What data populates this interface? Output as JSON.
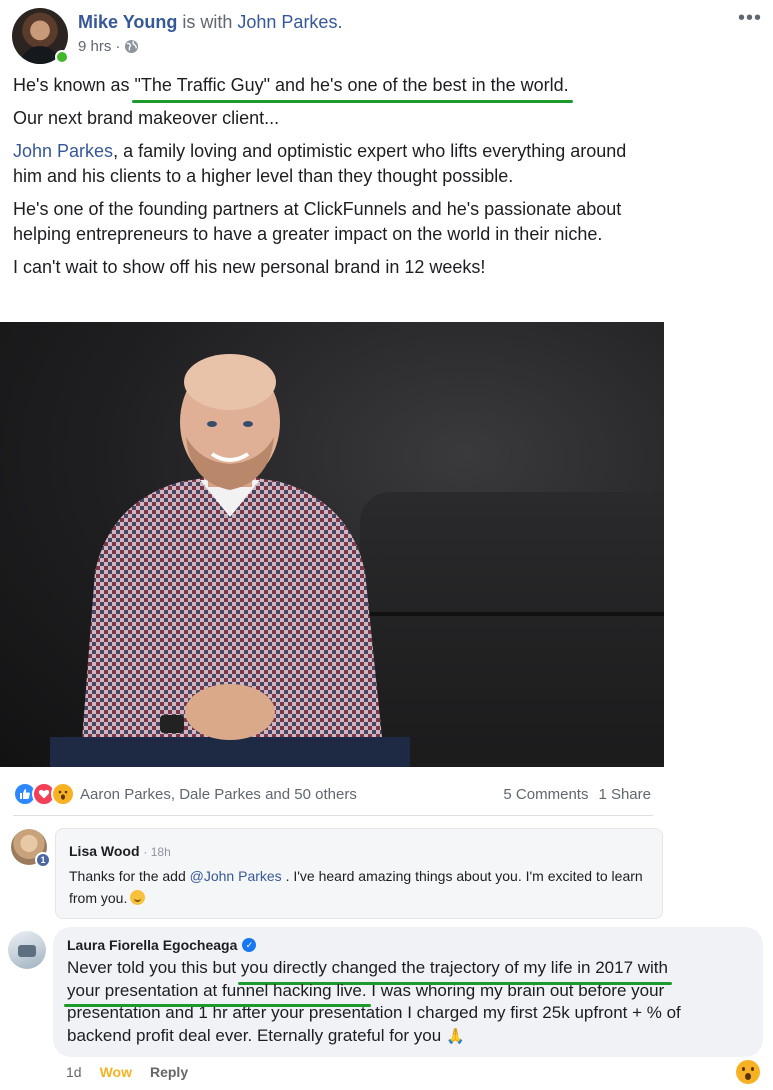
{
  "post": {
    "author": "Mike Young",
    "with_text": "is with",
    "tagged": "John Parkes.",
    "time": "9 hrs",
    "separator": "·",
    "more_label": "•••",
    "paragraphs": {
      "p1_before": "He's known as ",
      "p1_highlight": "\"The Traffic Guy\" and he's one of the best in the world.",
      "p2": "Our next brand makeover client...",
      "p3_link": "John Parkes",
      "p3_rest": ", a family loving and optimistic expert who lifts everything around him and his clients to a higher level than they thought possible.",
      "p4": "He's one of the founding partners at ClickFunnels and he's passionate about helping entrepreneurs to have a greater impact on the world in their niche.",
      "p5": "I can't wait to show off his new personal brand in 12 weeks!"
    }
  },
  "reactions": {
    "reactors": "Aaron Parkes, Dale Parkes and 50 others",
    "comments": "5 Comments",
    "shares": "1 Share",
    "icons": [
      "like-icon",
      "love-icon",
      "wow-icon"
    ]
  },
  "comment1": {
    "name": "Lisa Wood",
    "time": "· 18h",
    "badge": "1",
    "text_before": "Thanks for the add ",
    "mention": "@John Parkes",
    "text_after": " . I've heard amazing things about you. I'm excited to learn from you."
  },
  "comment2": {
    "name": "Laura Fiorella Egocheaga",
    "text_before": "Never told you this but ",
    "text_highlight1": "you directly changed the trajectory of my life in 2017 with",
    "text_highlight2": "your presentation at funnel hacking live.",
    "text_after": " I was whoring my brain out before your presentation and 1 hr after your presentation I charged my first 25k upfront + % of backend profit deal ever. Eternally grateful for you ",
    "emoji": "🙏",
    "actions": {
      "time": "1d",
      "wow": "Wow",
      "reply": "Reply"
    }
  },
  "colors": {
    "link": "#365899",
    "highlight_underline": "#1c9a2b",
    "wow": "#f7b125"
  }
}
